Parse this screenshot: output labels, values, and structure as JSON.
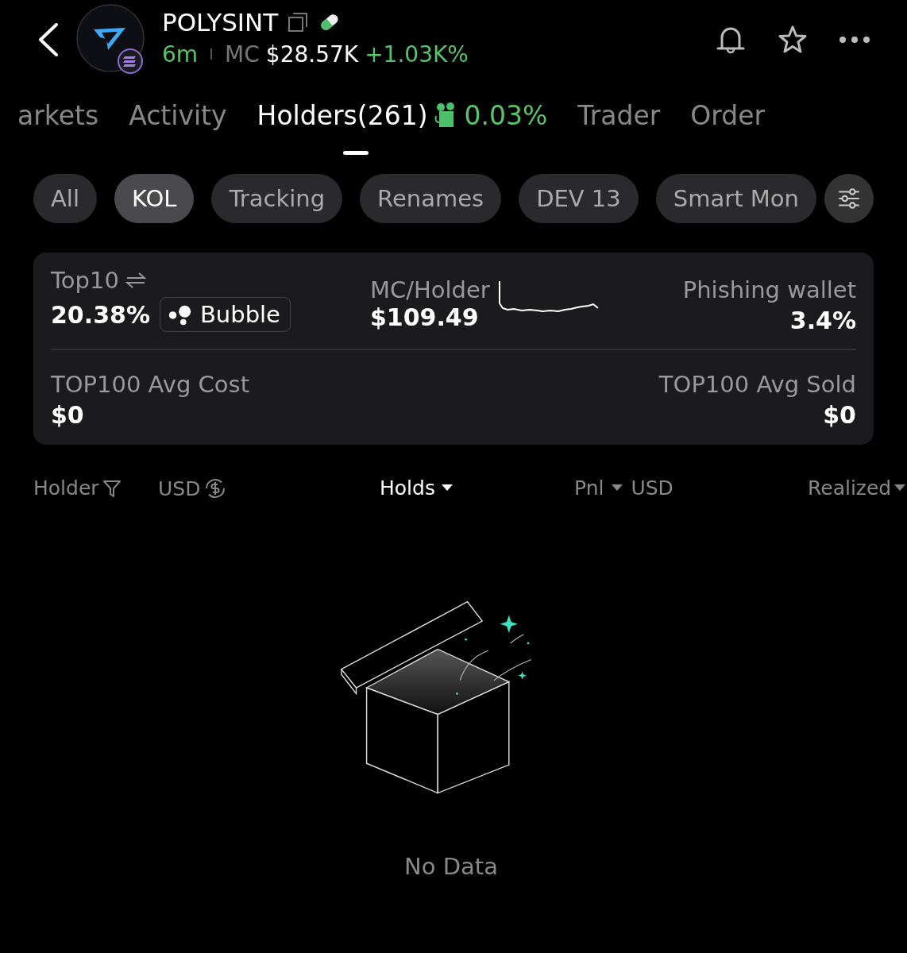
{
  "header": {
    "title": "POLYSINT",
    "age": "6m",
    "mc_label": "MC",
    "mc_value": "$28.57K",
    "change": "+1.03K%"
  },
  "tabs": [
    {
      "label": "arkets",
      "selected": false
    },
    {
      "label": "Activity",
      "selected": false
    },
    {
      "label": "Holders(261)",
      "selected": true,
      "extra": "0.03%"
    },
    {
      "label": "Trader",
      "selected": false
    },
    {
      "label": "Order",
      "selected": false
    }
  ],
  "chips": [
    {
      "label": "All",
      "selected": false
    },
    {
      "label": "KOL",
      "selected": true
    },
    {
      "label": "Tracking",
      "selected": false
    },
    {
      "label": "Renames",
      "selected": false
    },
    {
      "label": "DEV 13",
      "selected": false
    },
    {
      "label": "Smart Mon",
      "selected": false
    }
  ],
  "summary": {
    "top10_label": "Top10",
    "top10_value": "20.38%",
    "bubble": "Bubble",
    "mc_holder_label": "MC/Holder",
    "mc_holder_value": "$109.49",
    "phishing_label": "Phishing wallet",
    "phishing_value": "3.4%",
    "avg_cost_label": "TOP100 Avg Cost",
    "avg_cost_value": "$0",
    "avg_sold_label": "TOP100 Avg Sold",
    "avg_sold_value": "$0"
  },
  "columns": {
    "holder": "Holder",
    "usd": "USD",
    "holds": "Holds",
    "pnl": "Pnl",
    "pnl_usd": "USD",
    "realized": "Realized"
  },
  "empty": "No Data"
}
